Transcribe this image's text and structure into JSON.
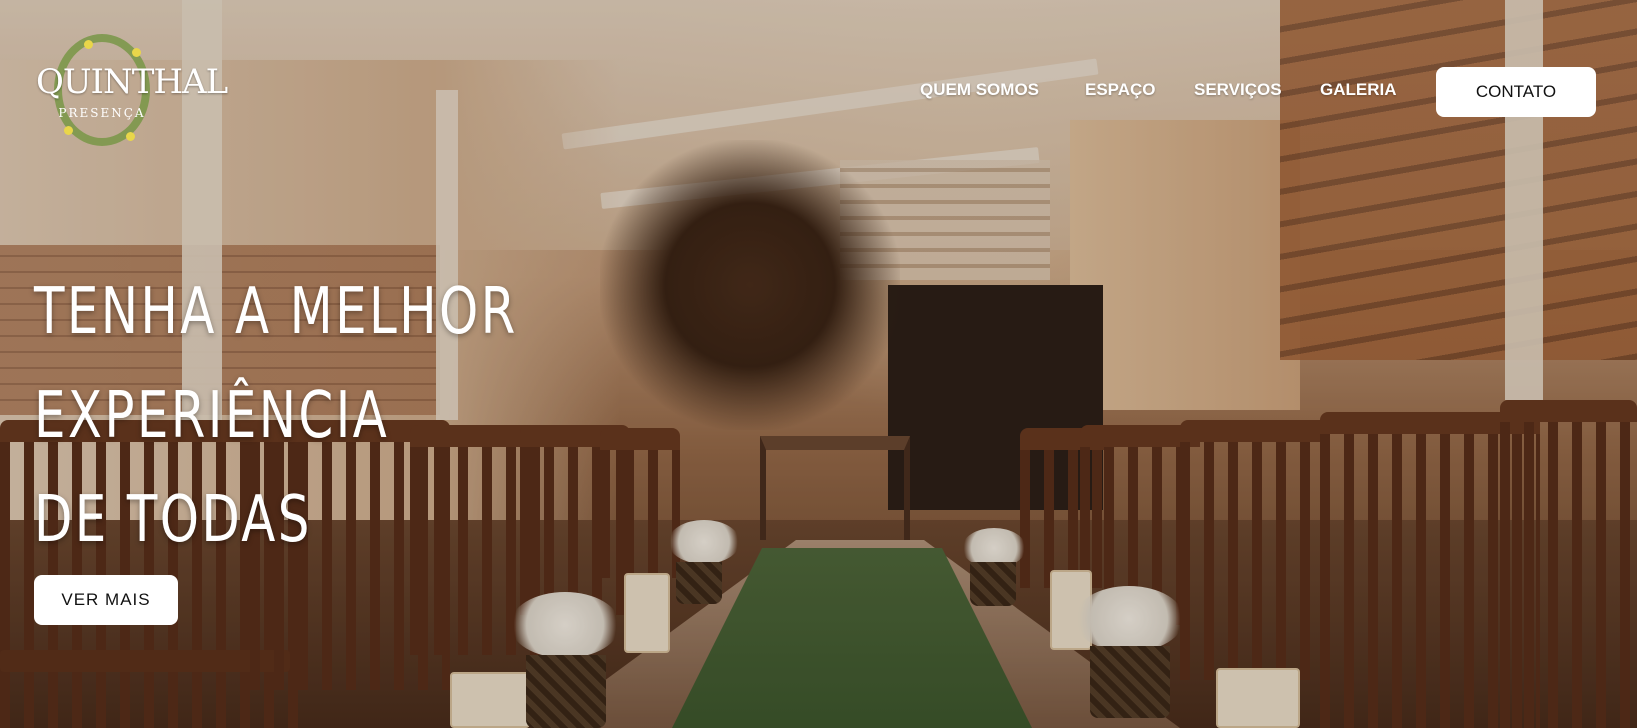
{
  "brand": {
    "name": "QUINTHAL",
    "subtitle": "PRESENÇA"
  },
  "nav": {
    "items": [
      {
        "label": "QUEM SOMOS"
      },
      {
        "label": "ESPAÇO"
      },
      {
        "label": "SERVIÇOS"
      },
      {
        "label": "GALERIA"
      }
    ],
    "contact_label": "CONTATO"
  },
  "hero": {
    "headline_lines": [
      "TENHA A MELHOR",
      "EXPERIÊNCIA",
      "DE TODAS"
    ],
    "cta_label": "VER MAIS"
  }
}
